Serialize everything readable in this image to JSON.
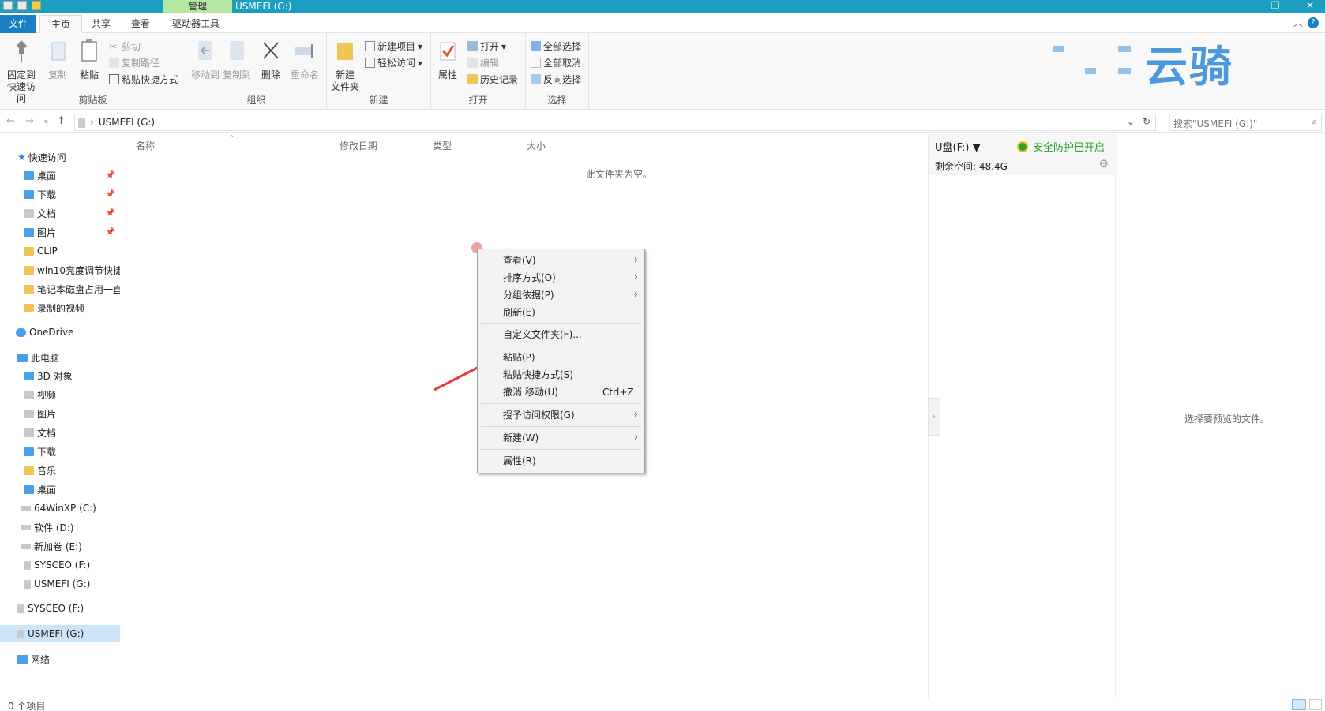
{
  "window": {
    "manage_tab": "管理",
    "title": "USMEFI (G:)"
  },
  "tabs": [
    "文件",
    "主页",
    "共享",
    "查看",
    "驱动器工具"
  ],
  "ribbon": {
    "clipboard": {
      "label": "剪贴板",
      "pin": "固定到\n快速访问",
      "pin_l1": "固定到",
      "pin_l2": "快速访问",
      "copy": "复制",
      "paste": "粘贴",
      "cut": "剪切",
      "copy_path": "复制路径",
      "paste_shortcut": "粘贴快捷方式"
    },
    "organize": {
      "label": "组织",
      "move_to": "移动到",
      "copy_to": "复制到",
      "delete": "删除",
      "rename": "重命名"
    },
    "new": {
      "label": "新建",
      "new_folder_l1": "新建",
      "new_folder_l2": "文件夹",
      "new_item": "新建项目",
      "easy_access": "轻松访问"
    },
    "open": {
      "label": "打开",
      "properties": "属性",
      "open": "打开",
      "edit": "编辑",
      "history": "历史记录"
    },
    "select": {
      "label": "选择",
      "select_all": "全部选择",
      "select_none": "全部取消",
      "invert": "反向选择"
    }
  },
  "watermark": "云骑",
  "address": {
    "path": "USMEFI (G:)",
    "search_placeholder": "搜索\"USMEFI (G:)\""
  },
  "nav": {
    "quick_access": "快速访问",
    "items_quick": [
      "桌面",
      "下载",
      "文档",
      "图片",
      "CLIP",
      "win10亮度调节快捷",
      "笔记本磁盘占用一直",
      "录制的视频"
    ],
    "onedrive": "OneDrive",
    "this_pc": "此电脑",
    "items_pc": [
      "3D 对象",
      "视频",
      "图片",
      "文档",
      "下载",
      "音乐",
      "桌面",
      "64WinXP  (C:)",
      "软件 (D:)",
      "新加卷 (E:)",
      "SYSCEO (F:)",
      "USMEFI (G:)"
    ],
    "sysceo": "SYSCEO (F:)",
    "usmefi": "USMEFI (G:)",
    "network": "网络"
  },
  "columns": {
    "name": "名称",
    "modified": "修改日期",
    "type": "类型",
    "size": "大小"
  },
  "empty_message": "此文件夹为空。",
  "usb": {
    "drive": "U盘(F:)",
    "protection": "安全防护已开启",
    "free_space": "剩余空间: 48.4G"
  },
  "preview_message": "选择要预览的文件。",
  "status": {
    "item_count": "0 个项目"
  },
  "context_menu": {
    "view": "查看(V)",
    "sort": "排序方式(O)",
    "group": "分组依据(P)",
    "refresh": "刷新(E)",
    "customize": "自定义文件夹(F)...",
    "paste": "粘贴(P)",
    "paste_shortcut": "粘贴快捷方式(S)",
    "undo": "撤消 移动(U)",
    "undo_shortcut": "Ctrl+Z",
    "grant_access": "授予访问权限(G)",
    "new": "新建(W)",
    "properties": "属性(R)"
  },
  "colors": {
    "titlebar": "#1a9fc0",
    "manage_tab": "#b5e6a2",
    "file_tab": "#1a7fc0",
    "arrow": "#e53935",
    "shield": "#2aa52a"
  }
}
